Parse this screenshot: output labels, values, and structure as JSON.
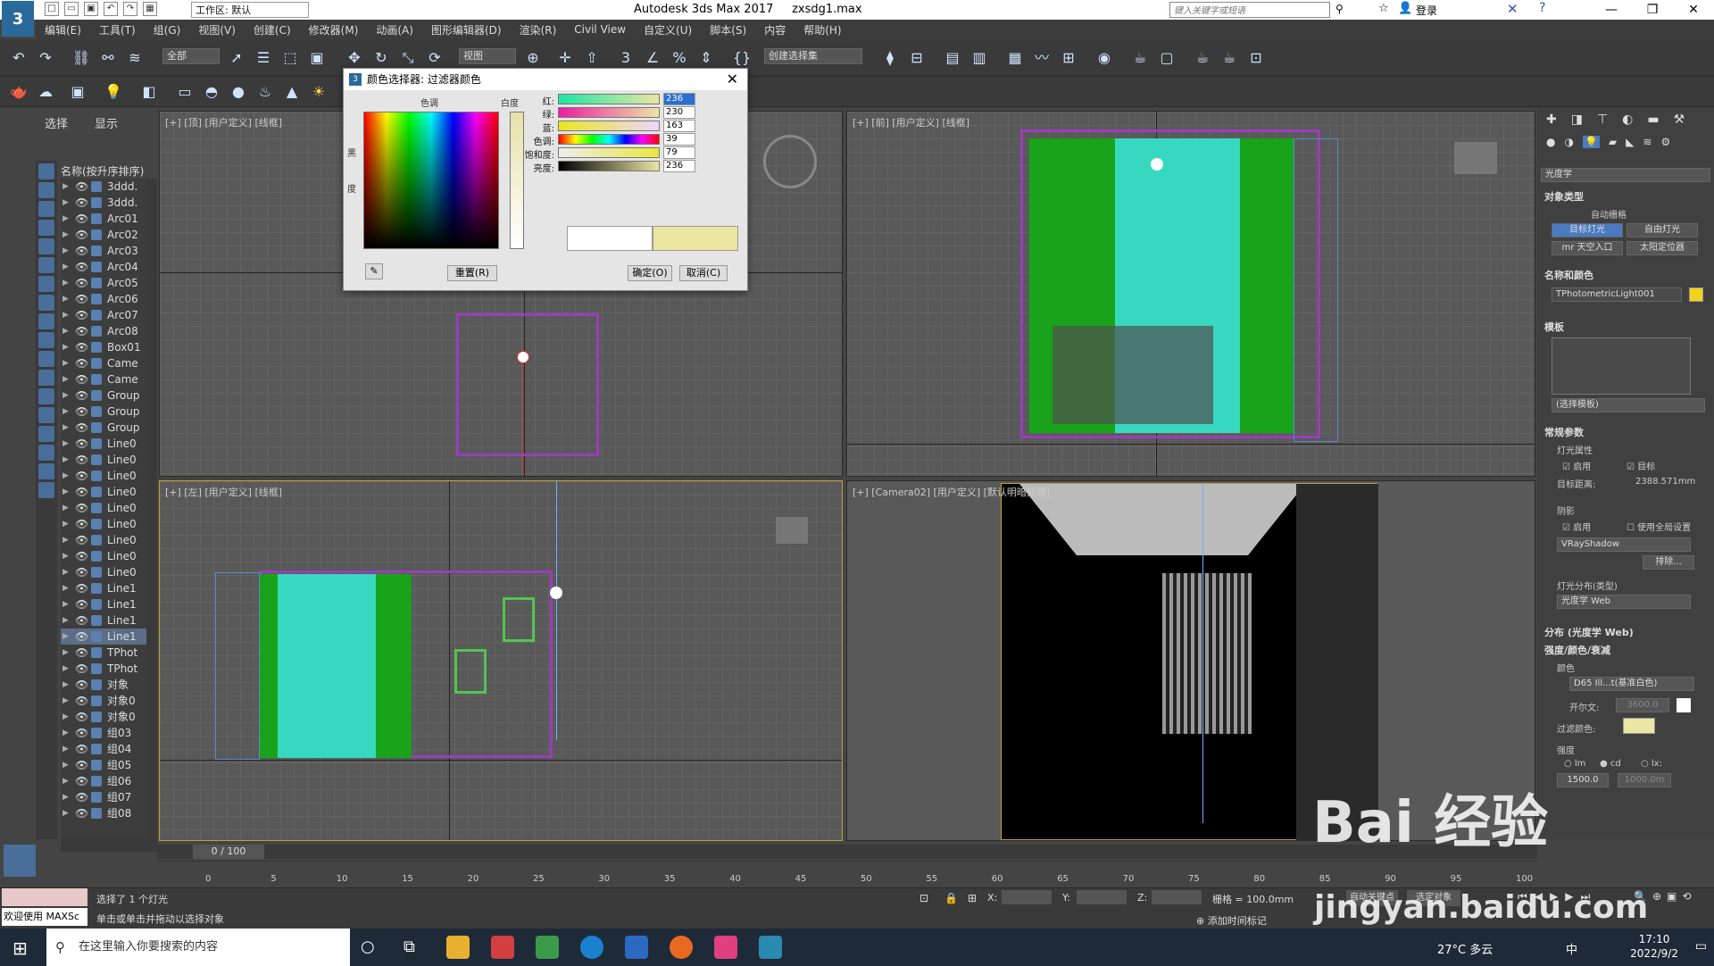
{
  "app": {
    "logo": "3",
    "workspace": "工作区: 默认",
    "title": "Autodesk 3ds Max 2017",
    "file": "zxsdg1.max",
    "search_placeholder": "键入关键字或短语",
    "login": "登录"
  },
  "menu": [
    "编辑(E)",
    "工具(T)",
    "组(G)",
    "视图(V)",
    "创建(C)",
    "修改器(M)",
    "动画(A)",
    "图形编辑器(D)",
    "渲染(R)",
    "Civil View",
    "自定义(U)",
    "脚本(S)",
    "内容",
    "帮助(H)"
  ],
  "toolbar": {
    "filter": "全部",
    "view_dropdown": "视图",
    "selection_set": "创建选择集"
  },
  "scene_explorer": {
    "tabs": [
      "选择",
      "显示"
    ],
    "header": "名称(按升序排序)",
    "items": [
      "3ddd.",
      "3ddd.",
      "Arc01",
      "Arc02",
      "Arc03",
      "Arc04",
      "Arc05",
      "Arc06",
      "Arc07",
      "Arc08",
      "Box01",
      "Came",
      "Came",
      "Group",
      "Group",
      "Group",
      "Line0",
      "Line0",
      "Line0",
      "Line0",
      "Line0",
      "Line0",
      "Line0",
      "Line0",
      "Line0",
      "Line1",
      "Line1",
      "Line1",
      "Line1",
      "TPhot",
      "TPhot",
      "对象",
      "对象0",
      "对象0",
      "组03",
      "组04",
      "组05",
      "组06",
      "组07",
      "组08"
    ]
  },
  "viewports": {
    "top": "[+] [顶] [用户定义] [线框]",
    "front": "[+] [前] [用户定义] [线框]",
    "left": "[+] [左] [用户定义] [线框]",
    "camera": "[+] [Camera02] [用户定义] [默认明暗处理]"
  },
  "color_dialog": {
    "title": "颜色选择器: 过滤器颜色",
    "hue_header": "色调",
    "white_header": "白度",
    "black_label_1": "黑",
    "black_label_2": "度",
    "sliders": [
      {
        "label": "红:",
        "value": "236"
      },
      {
        "label": "绿:",
        "value": "230"
      },
      {
        "label": "蓝:",
        "value": "163"
      },
      {
        "label": "色调:",
        "value": "39"
      },
      {
        "label": "饱和度:",
        "value": "79"
      },
      {
        "label": "亮度:",
        "value": "236"
      }
    ],
    "reset": "重置(R)",
    "ok": "确定(O)",
    "cancel": "取消(C)",
    "new_color": "#ece6a3"
  },
  "command_panel": {
    "category": "光度学",
    "object_type": "对象类型",
    "autogrid": "自动栅格",
    "btn_target": "目标灯光",
    "btn_free": "自由灯光",
    "btn_mr_sky": "mr 天空入口",
    "btn_sun": "太阳定位器",
    "name_color": "名称和颜色",
    "object_name": "TPhotometricLight001",
    "template": "模板",
    "template_choice": "(选择模板)",
    "general": "常规参数",
    "light_props": "灯光属性",
    "enable": "启用",
    "targeted": "目标",
    "target_dist_label": "目标距离:",
    "target_dist": "2388.571mm",
    "shadows": "阴影",
    "shadow_enable": "启用",
    "use_global": "使用全局设置",
    "shadow_type": "VRayShadow",
    "exclude": "排除...",
    "distribution": "灯光分布(类型)",
    "distribution_type": "光度学 Web",
    "dist_web": "分布 (光度学 Web)",
    "intensity_color": "强度/颜色/衰减",
    "color_label": "颜色",
    "color_preset": "D65 Ill...t(基准白色)",
    "kelvin_label": "开尔文:",
    "kelvin": "3600.0",
    "filter_color_label": "过滤颜色:",
    "filter_color": "#ece6a3",
    "intensity_label": "强度",
    "unit_lm": "lm",
    "unit_cd": "cd",
    "unit_lx": "lx:",
    "intensity_value": "1500.0",
    "lx_value": "1000.0m"
  },
  "timeline": {
    "frame": "0 / 100",
    "ticks": [
      "0",
      "5",
      "10",
      "15",
      "20",
      "25",
      "30",
      "35",
      "40",
      "45",
      "50",
      "55",
      "60",
      "65",
      "70",
      "75",
      "80",
      "85",
      "90",
      "95",
      "100"
    ]
  },
  "status": {
    "welcome": "欢迎使用 MAXSc",
    "selected": "选择了 1 个灯光",
    "hint": "单击或单击并拖动以选择对象",
    "x_label": "X:",
    "y_label": "Y:",
    "z_label": "Z:",
    "grid": "栅格 = 100.0mm",
    "add_time_tag": "添加时间标记",
    "auto_key": "自动关键点",
    "selected_obj": "选定对象"
  },
  "taskbar": {
    "search": "在这里输入你要搜索的内容",
    "weather": "27°C 多云",
    "ime": "中",
    "time": "17:10",
    "date": "2022/9/2"
  },
  "watermark": {
    "main": "Bai 经验",
    "url": "jingyan.baidu.com"
  }
}
